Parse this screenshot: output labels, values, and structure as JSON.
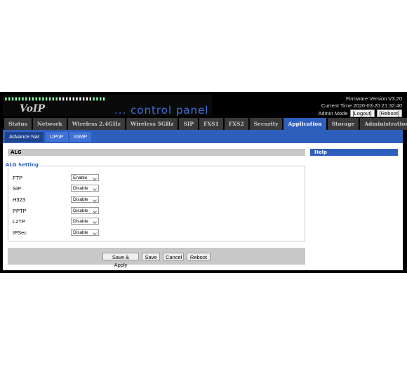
{
  "header": {
    "brand": "VoIP",
    "tagline": "... control panel",
    "firmware": "Firmware Version V3.20",
    "current_time": "Current Time 2020-03-20 21:32:40",
    "admin_mode_label": "Admin Mode",
    "logout_label": "[Logout]",
    "reboot_label": "[Reboot]"
  },
  "tabs": [
    "Status",
    "Network",
    "Wireless 2.4GHz",
    "Wireless 5GHz",
    "SIP",
    "FXS1",
    "FXS2",
    "Security",
    "Application",
    "Storage",
    "Administration"
  ],
  "active_tab": "Application",
  "subtabs": [
    "Advance Nat",
    "UPnP",
    "IGMP"
  ],
  "active_subtab": "Advance Nat",
  "section_title": "ALG",
  "help_title": "Help",
  "fieldset_legend": "ALG Setting",
  "fields": [
    {
      "label": "FTP",
      "value": "Enable"
    },
    {
      "label": "SIP",
      "value": "Disable"
    },
    {
      "label": "H323",
      "value": "Disable"
    },
    {
      "label": "PPTP",
      "value": "Disable"
    },
    {
      "label": "L2TP",
      "value": "Disable"
    },
    {
      "label": "IPSec",
      "value": "Disable"
    }
  ],
  "buttons": {
    "save_apply": "Save & Apply",
    "save": "Save",
    "cancel": "Cancel",
    "reboot": "Reboot"
  },
  "colors": {
    "accent": "#2f5fbd",
    "tab_bg": "#3a3a3a",
    "frame": "#000000"
  }
}
